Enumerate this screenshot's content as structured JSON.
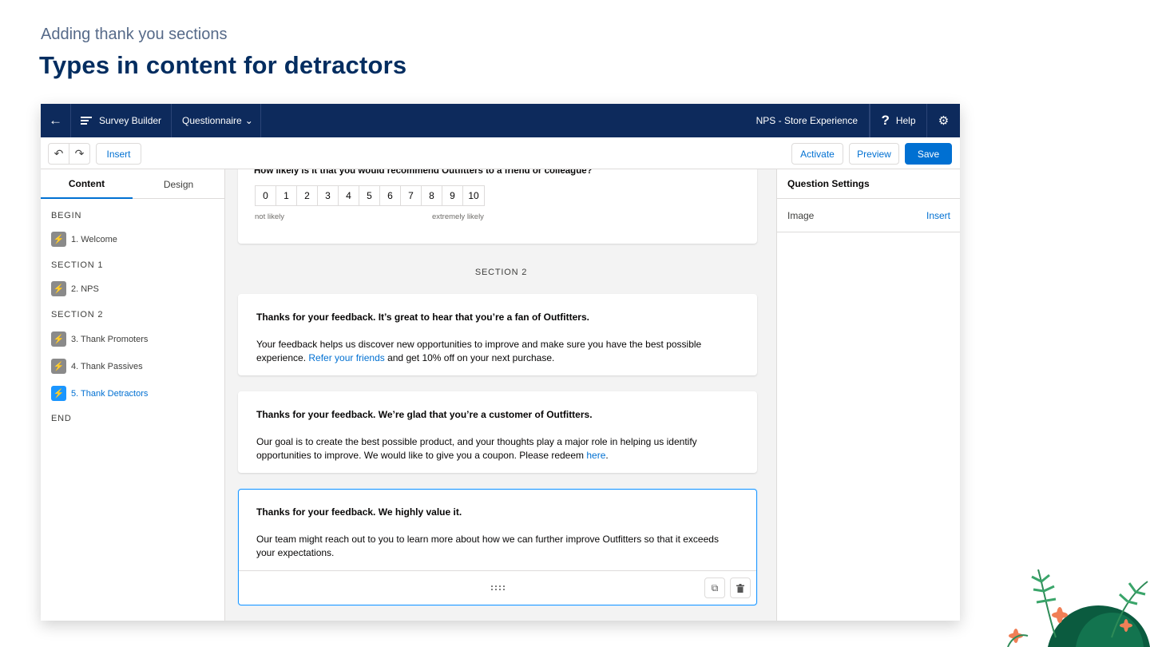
{
  "slide": {
    "subtitle": "Adding thank you sections",
    "title": "Types in content for detractors"
  },
  "navbar": {
    "back_icon": "arrow-left-icon",
    "app_name": "Survey  Builder",
    "menu_label": "Questionnaire",
    "survey_name": "NPS - Store Experience",
    "help_label": "Help"
  },
  "toolbar": {
    "undo_glyph": "↶",
    "redo_glyph": "↷",
    "insert_label": "Insert",
    "activate_label": "Activate",
    "preview_label": "Preview",
    "save_label": "Save"
  },
  "left_panel": {
    "tabs": [
      "Content",
      "Design"
    ],
    "outline": {
      "begin": "BEGIN",
      "item1": "1. Welcome",
      "section1": "SECTION 1",
      "item2": "2. NPS",
      "section2": "SECTION 2",
      "item3": "3. Thank Promoters",
      "item4": "4. Thank Passives",
      "item5": "5. Thank Detractors",
      "end": "END"
    }
  },
  "canvas": {
    "question": {
      "title": "How likely is it that you would recommend Outfitters to a friend or colleague?",
      "scale": [
        "0",
        "1",
        "2",
        "3",
        "4",
        "5",
        "6",
        "7",
        "8",
        "9",
        "10"
      ],
      "low_label": "not likely",
      "high_label": "extremely likely"
    },
    "section_label": "SECTION 2",
    "promoters": {
      "title": "Thanks for your feedback. It’s great to hear that you’re a fan of Outfitters.",
      "body_part1": "Your feedback helps us discover new opportunities to improve and make sure you have the best possible experience. ",
      "link": "Refer your friends",
      "body_part2": " and get 10% off on your next purchase."
    },
    "passives": {
      "title": "Thanks for your feedback. We’re glad that you’re a customer of Outfitters.",
      "body_part1": "Our goal is to create the best possible product, and your thoughts play a major role in helping us identify opportunities to improve. We would like to give you a coupon. Please redeem ",
      "link": "here",
      "body_part2": "."
    },
    "detractors": {
      "title": "Thanks for your feedback. We highly value it.",
      "body": "Our team might reach out to you to learn more about how we can further improve Outfitters so that it exceeds your expectations."
    }
  },
  "right_panel": {
    "header": "Question Settings",
    "image_label": "Image",
    "insert_link": "Insert"
  },
  "colors": {
    "navbar": "#0d2a5c",
    "title": "#032d60",
    "accent": "#0070d2"
  }
}
